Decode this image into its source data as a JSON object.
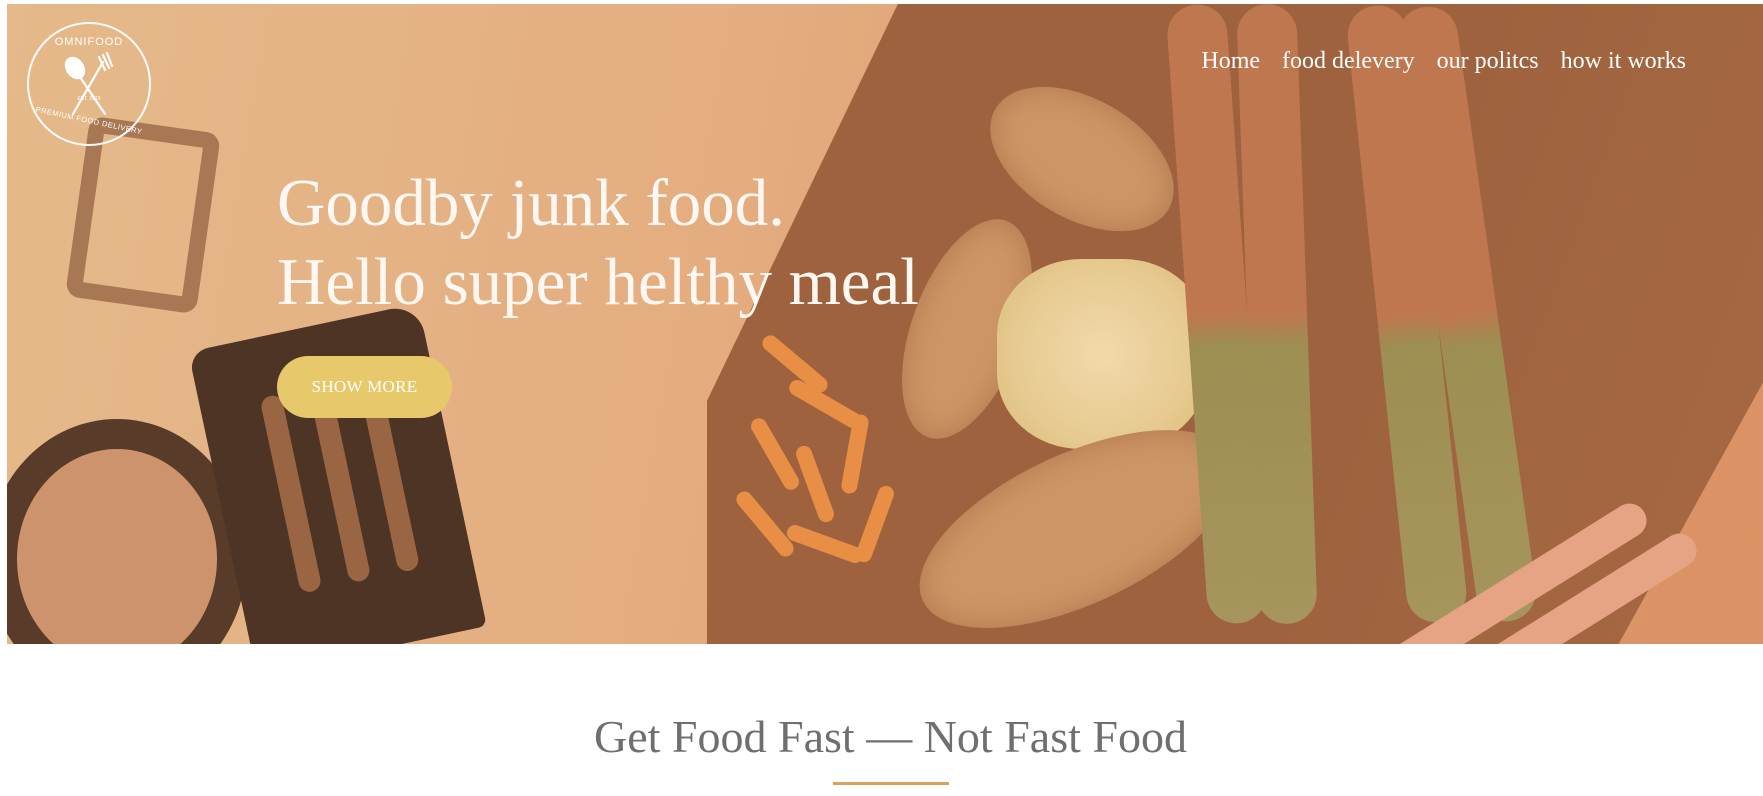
{
  "logo": {
    "brand": "OMNIFOOD",
    "established": "EST. 2019",
    "tagline": "PREMIUM FOOD DELIVERY"
  },
  "nav": {
    "items": [
      {
        "label": "Home"
      },
      {
        "label": "food delevery"
      },
      {
        "label": "our politcs"
      },
      {
        "label": "how it works"
      }
    ]
  },
  "hero": {
    "headline_line1": "Goodby junk food.",
    "headline_line2": "Hello super helthy meal",
    "cta_label": "SHOW MORE"
  },
  "section": {
    "title": "Get Food Fast — Not Fast Food"
  },
  "colors": {
    "accent": "#e7c86a",
    "rule": "#d9a062",
    "title_text": "#6f6f6f",
    "hero_overlay": "#e6a06e"
  }
}
